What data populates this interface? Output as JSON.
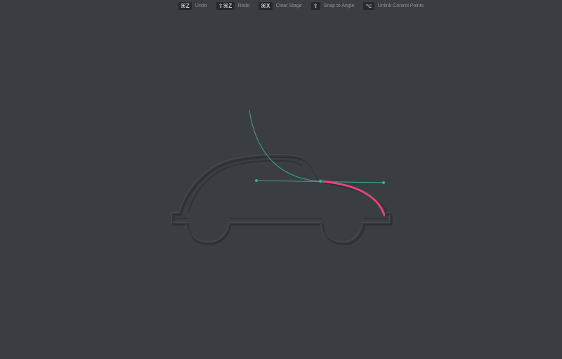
{
  "toolbar": {
    "shortcuts": [
      {
        "key": "⌘Z",
        "label": "Undo"
      },
      {
        "key": "⇧⌘Z",
        "label": "Redo"
      },
      {
        "key": "⌘X",
        "label": "Clear Stage"
      },
      {
        "key": "⇧",
        "label": "Snap to Angle"
      },
      {
        "key": "⌥",
        "label": "Unlink Control Points"
      }
    ]
  },
  "colors": {
    "background": "#3a3e42",
    "guide": "#3fa894",
    "active_path": "#e8457a",
    "embossed_dark": "#2c3033",
    "embossed_light": "#464b50"
  },
  "stage": {
    "shape_icon": "car-silhouette-icon",
    "handle_icon": "control-point-icon"
  }
}
